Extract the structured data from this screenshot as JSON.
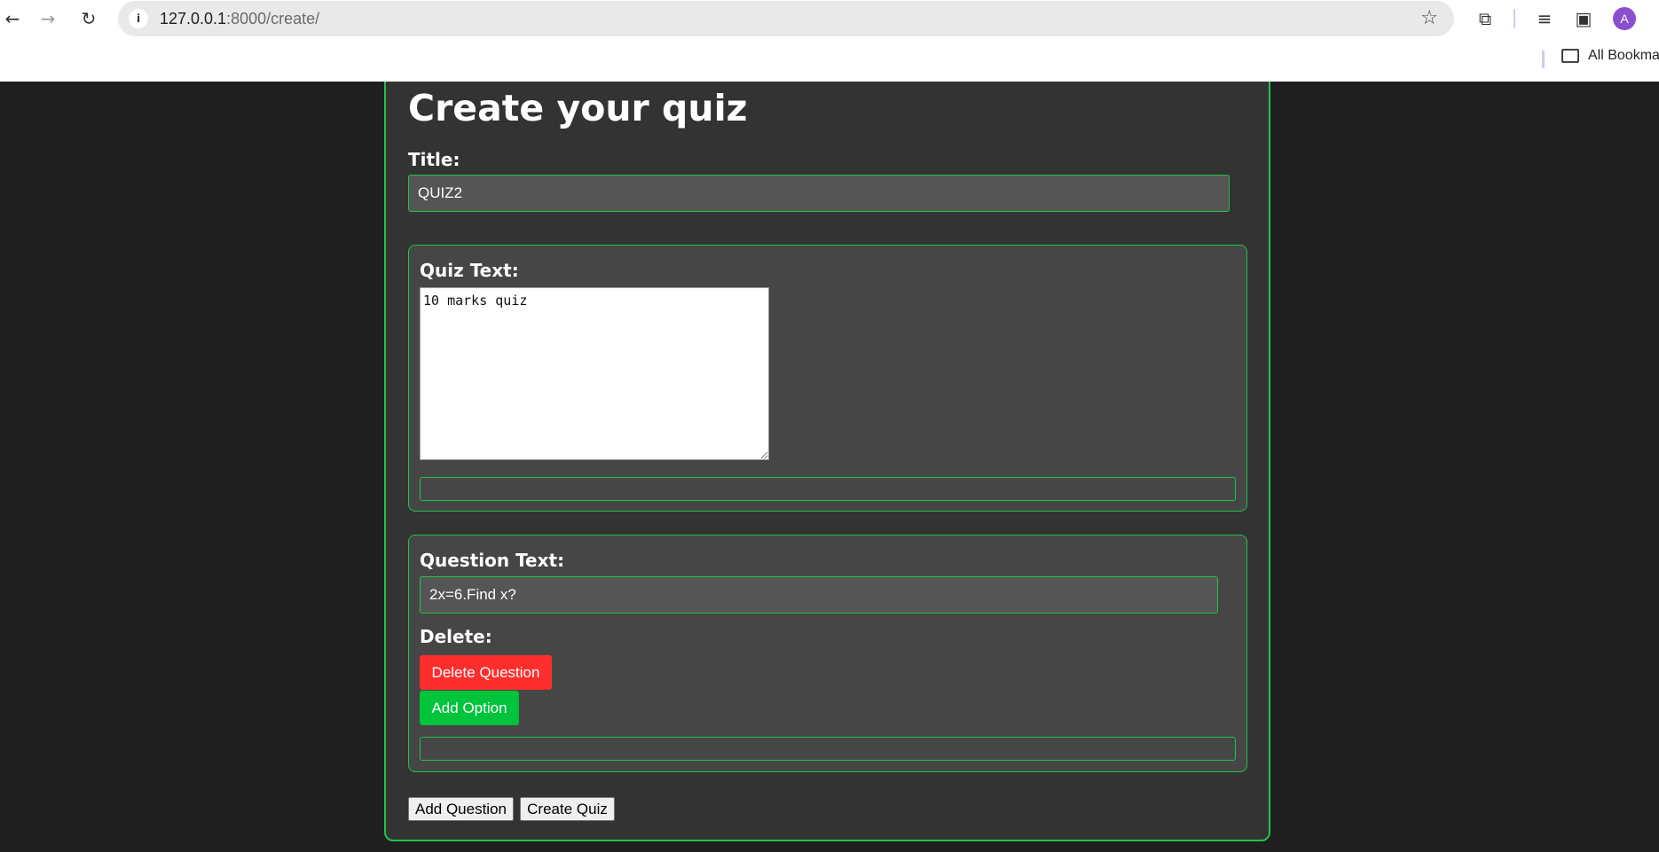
{
  "browser": {
    "url_host": "127.0.0.1",
    "url_path": ":8000/create/",
    "bookmarks_label": "All Bookmarks",
    "profile_initial": "A"
  },
  "icons": {
    "back": "back-arrow-icon",
    "forward": "forward-arrow-icon",
    "reload": "reload-icon",
    "site_info": "info-icon",
    "bookmark_star": "star-icon",
    "extensions": "puzzle-icon",
    "media": "media-controls-icon",
    "side_panel": "side-panel-icon",
    "bookmarks_folder": "folder-icon"
  },
  "page": {
    "title": "Create your quiz",
    "title_label": "Title:",
    "title_value": "QUIZ2",
    "quiz_text_label": "Quiz Text:",
    "quiz_text_value": "10 marks quiz",
    "question_text_label": "Question Text:",
    "question_text_value": "2x=6.Find x?",
    "delete_label": "Delete:",
    "delete_question_button": "Delete Question",
    "add_option_button": "Add Option",
    "add_question_button": "Add Question",
    "create_quiz_button": "Create Quiz"
  },
  "colors": {
    "accent_green": "#22c24a",
    "delete_red": "#ff2e2e",
    "add_green": "#00c43c",
    "page_bg": "#1f1f1f",
    "card_bg": "#333333",
    "section_bg": "#464646"
  }
}
